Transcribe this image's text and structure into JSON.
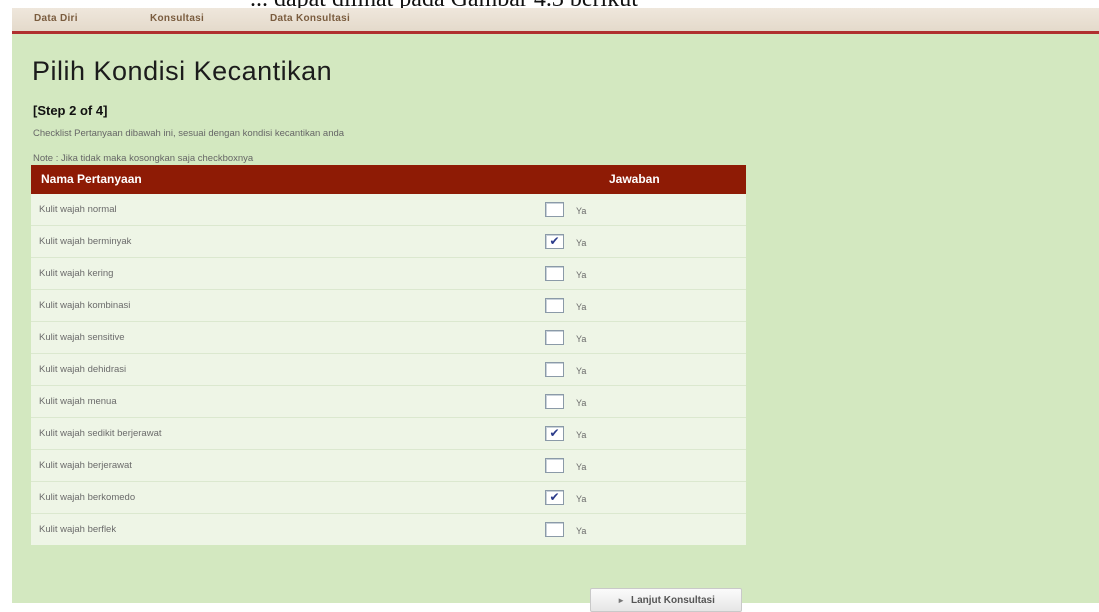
{
  "caption": "... dapat dilihat pada Gambar 4.3 berikut",
  "nav": {
    "items": [
      {
        "label": "Data Diri"
      },
      {
        "label": "Konsultasi"
      },
      {
        "label": "Data Konsultasi"
      }
    ]
  },
  "page": {
    "title": "Pilih Kondisi Kecantikan",
    "step": "[Step 2 of 4]",
    "instruction": "Checklist Pertanyaan dibawah ini, sesuai dengan kondisi kecantikan anda",
    "note": "Note : Jika tidak maka kosongkan saja checkboxnya"
  },
  "table": {
    "headers": {
      "question": "Nama Pertanyaan",
      "answer": "Jawaban"
    },
    "answer_label": "Ya",
    "rows": [
      {
        "question": "Kulit wajah normal",
        "checked": false
      },
      {
        "question": "Kulit wajah berminyak",
        "checked": true
      },
      {
        "question": "Kulit wajah kering",
        "checked": false
      },
      {
        "question": "Kulit wajah kombinasi",
        "checked": false
      },
      {
        "question": "Kulit wajah sensitive",
        "checked": false
      },
      {
        "question": "Kulit wajah dehidrasi",
        "checked": false
      },
      {
        "question": "Kulit wajah menua",
        "checked": false
      },
      {
        "question": "Kulit wajah sedikit berjerawat",
        "checked": true
      },
      {
        "question": "Kulit wajah berjerawat",
        "checked": false
      },
      {
        "question": "Kulit wajah berkomedo",
        "checked": true
      },
      {
        "question": "Kulit wajah berflek",
        "checked": false
      }
    ]
  },
  "submit": {
    "label": "Lanjut Konsultasi",
    "icon": "arrow-right-icon"
  },
  "colors": {
    "background": "#d3e8c0",
    "header": "#8e1b05",
    "nav_border": "#b02f2f"
  }
}
